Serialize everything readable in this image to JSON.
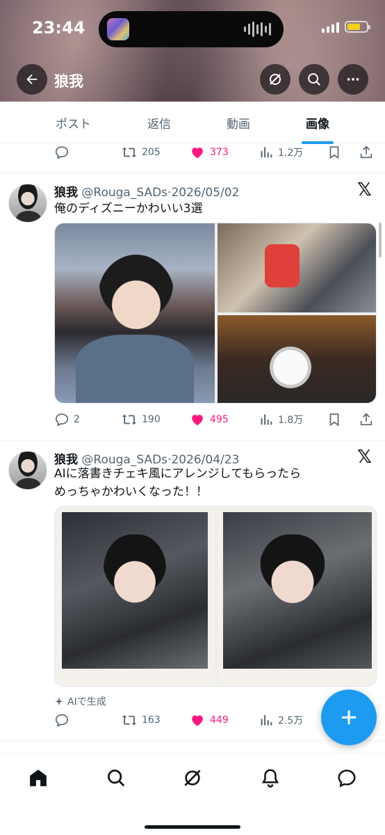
{
  "status_bar": {
    "time": "23:44"
  },
  "header": {
    "title": "狼我"
  },
  "tabs": [
    {
      "label": "ポスト",
      "active": false
    },
    {
      "label": "返信",
      "active": false
    },
    {
      "label": "動画",
      "active": false
    },
    {
      "label": "画像",
      "active": true
    }
  ],
  "top_actions": {
    "reposts": "205",
    "likes": "373",
    "views": "1.2万"
  },
  "posts": [
    {
      "name": "狼我",
      "handle": "@Rouga_SADs",
      "date": "2026/05/02",
      "text_line1": "俺のディズニーかわいい3選",
      "text_line2": "",
      "replies": "2",
      "reposts": "190",
      "likes": "495",
      "views": "1.8万"
    },
    {
      "name": "狼我",
      "handle": "@Rouga_SADs",
      "date": "2026/04/23",
      "text_line1": "AIに落書きチェキ風にアレンジしてもらったら",
      "text_line2": "めっちゃかわいくなった！！",
      "ai_label": "AIで生成",
      "replies": "",
      "reposts": "163",
      "likes": "449",
      "views": "2.5万"
    }
  ],
  "colors": {
    "like": "#f91880",
    "accent": "#1d9bf0",
    "text": "#0f1419",
    "muted": "#536471"
  }
}
